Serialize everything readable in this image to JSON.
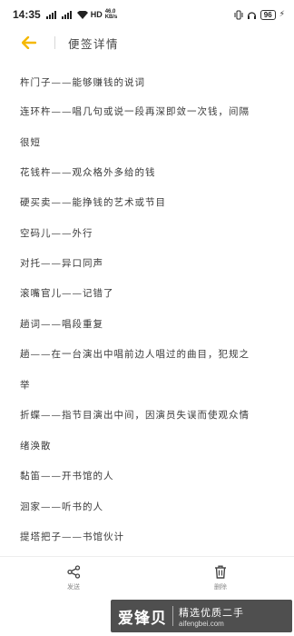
{
  "status_bar": {
    "time": "14:35",
    "signal_1": "5G▗▙▟",
    "signal_2": "4G▗▙▟",
    "network_speed": "46.0\nKB/s",
    "hd": "HD",
    "battery": "96"
  },
  "header": {
    "title": "便签详情",
    "accent_color": "#f5b800"
  },
  "note_lines": [
    "杵门子——能够赚钱的说词",
    "连环杵——唱几句或说一段再深即敛一次钱，间隔",
    "很短",
    "花钱杵——观众格外多给的钱",
    "硬买卖——能挣钱的艺术或节目",
    "空码儿——外行",
    "对托——异口同声",
    "滚嘴官儿——记错了",
    "趟词——唱段重复",
    "趟——在一台演出中唱前边人唱过的曲目，犯规之",
    "举",
    "折蝶——指节目演出中间，因演员失误而使观众情",
    "绪涣散",
    "黏笛——开书馆的人",
    "洄家——听书的人",
    "提塔把子——书馆伙计"
  ],
  "bottom_bar": {
    "share_label": "发送",
    "delete_label": "删除"
  },
  "watermark": {
    "logo": "爱锋贝",
    "slogan": "精选优质二手",
    "domain": "aifengbei.com"
  }
}
